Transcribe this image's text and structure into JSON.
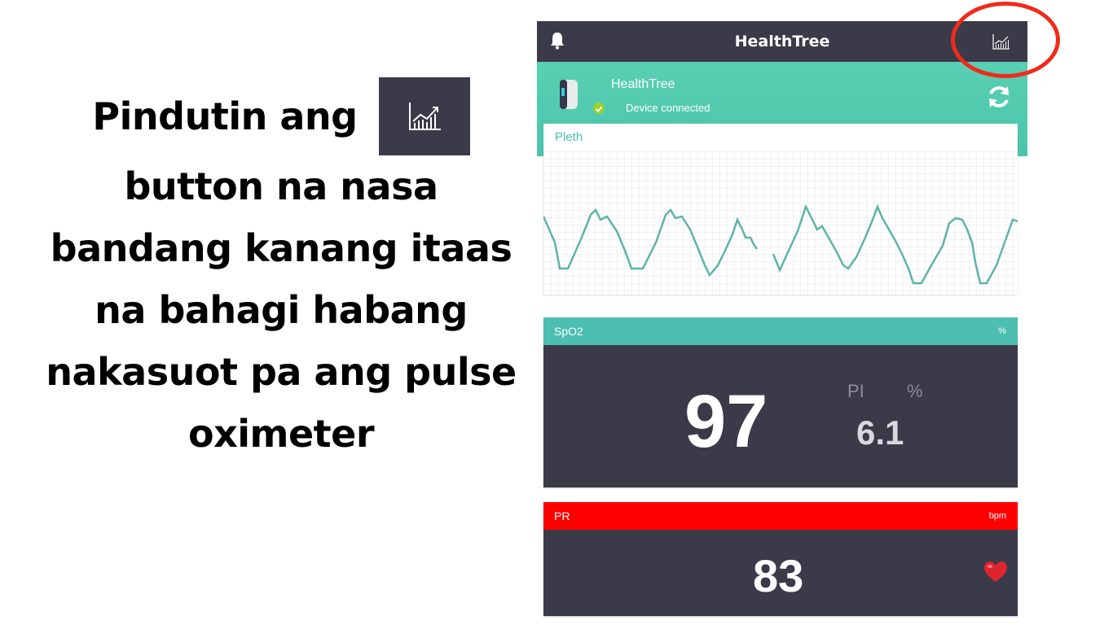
{
  "instruction": {
    "line1": "Pindutin ang",
    "rest": [
      "button na nasa",
      "bandang kanang itaas",
      "na bahagi habang",
      "nakasuot pa ang pulse",
      "oximeter"
    ],
    "button_icon": "bar-chart-trend-icon"
  },
  "app": {
    "title": "HealthTree",
    "top_left_icon": "bell-icon",
    "top_right_icon": "bar-chart-trend-icon",
    "device": {
      "name": "HealthTree",
      "status": "Device connected",
      "status_icon": "check-circle-icon",
      "refresh_icon": "refresh-icon"
    },
    "pleth": {
      "label": "Pleth"
    },
    "spo2": {
      "label": "SpO2",
      "unit": "%",
      "value": "97",
      "pi_label": "PI",
      "pi_unit": "%",
      "pi_value": "6.1"
    },
    "pr": {
      "label": "PR",
      "unit": "bpm",
      "value": "83",
      "heart_icon": "heart-icon"
    }
  },
  "colors": {
    "topbar": "#3a3a48",
    "teal": "#4cbfb0",
    "pr_red": "#ff0000",
    "highlight_circle": "#ef2b1b"
  }
}
